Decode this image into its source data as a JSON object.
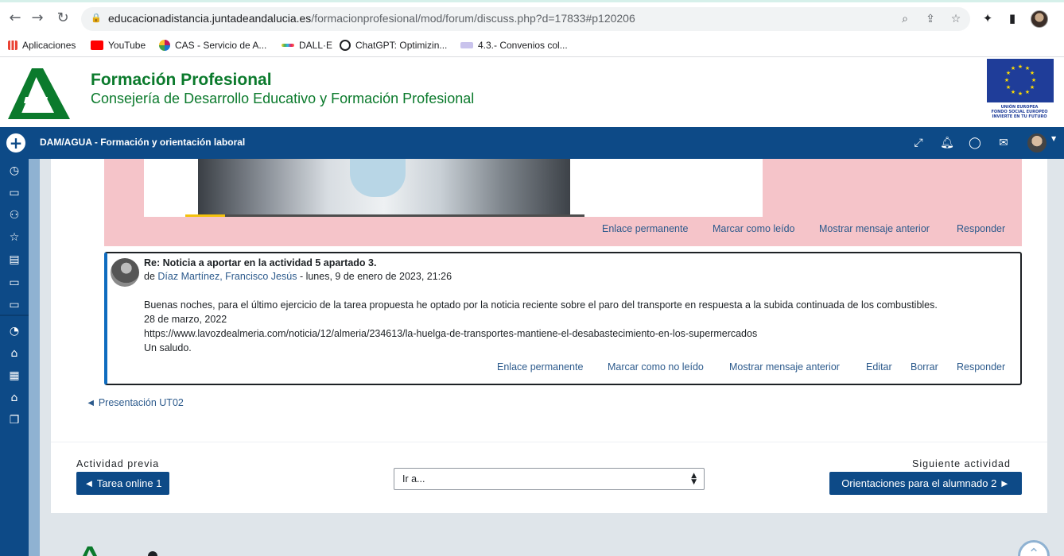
{
  "browser": {
    "url_host": "educacionadistancia.juntadeandalucia.es",
    "url_path": "/formacionprofesional/mod/forum/discuss.php?d=17833#p120206",
    "bookmarks": [
      {
        "label": "Aplicaciones",
        "icon": "apps-grid-icon",
        "color": "#ea4335"
      },
      {
        "label": "YouTube",
        "icon": "youtube-icon",
        "color": "#ff0000"
      },
      {
        "label": "CAS - Servicio de A...",
        "icon": "cas-icon",
        "color": "#c2185b"
      },
      {
        "label": "DALL·E",
        "icon": "dalle-icon",
        "color": "#444444"
      },
      {
        "label": "ChatGPT: Optimizin...",
        "icon": "chatgpt-icon",
        "color": "#202124"
      },
      {
        "label": "4.3.- Convenios col...",
        "icon": "doc-icon",
        "color": "#6d5fb5"
      }
    ]
  },
  "header": {
    "title": "Formación Profesional",
    "subtitle": "Consejería de Desarrollo Educativo y Formación Profesional",
    "eu_text_1": "UNIÓN EUROPEA",
    "eu_text_2": "FONDO SOCIAL EUROPEO",
    "eu_text_3": "INVIERTE EN TU FUTURO",
    "brand_color": "#0b7a2c"
  },
  "navbar": {
    "course": "DAM/AGUA - Formación y orientación laboral",
    "color": "#0d4a87"
  },
  "post1": {
    "image_progress": 0.1,
    "links": {
      "permalink": "Enlace permanente",
      "mark": "Marcar como leído",
      "prev": "Mostrar mensaje anterior",
      "reply": "Responder"
    }
  },
  "post2": {
    "subject": "Re: Noticia a aportar en la actividad 5 apartado 3.",
    "by": "de",
    "author": "Díaz Martínez, Francisco Jesús",
    "date": "- lunes, 9 de enero de 2023, 21:26",
    "lines": [
      "Buenas noches, para el último ejercicio de la tarea propuesta he optado por la noticia reciente sobre el paro del transporte en respuesta a la subida continuada de los combustibles.",
      "28 de marzo, 2022",
      "https://www.lavozdealmeria.com/noticia/12/almeria/234613/la-huelga-de-transportes-mantiene-el-desabastecimiento-en-los-supermercados",
      "Un saludo."
    ],
    "links": {
      "permalink": "Enlace permanente",
      "mark": "Marcar como no leído",
      "prev": "Mostrar mensaje anterior",
      "edit": "Editar",
      "delete": "Borrar",
      "reply": "Responder"
    }
  },
  "nav": {
    "prev_discussion": "◄ Presentación UT02",
    "prev_activity_label": "Actividad previa",
    "prev_activity_button": "◄ Tarea online 1",
    "jump_value": "Ir a...",
    "next_activity_label": "Siguiente actividad",
    "next_activity_button": "Orientaciones para el alumnado 2 ►"
  }
}
